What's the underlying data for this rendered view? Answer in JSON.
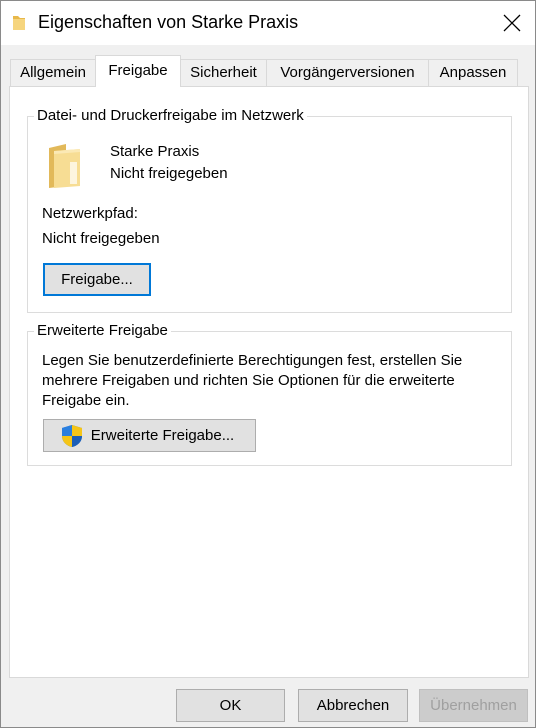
{
  "window": {
    "title": "Eigenschaften von Starke Praxis"
  },
  "tabs": [
    {
      "label": "Allgemein"
    },
    {
      "label": "Freigabe"
    },
    {
      "label": "Sicherheit"
    },
    {
      "label": "Vorgängerversionen"
    },
    {
      "label": "Anpassen"
    }
  ],
  "active_tab": "Freigabe",
  "network_sharing": {
    "title": "Datei- und Druckerfreigabe im Netzwerk",
    "folder_name": "Starke Praxis",
    "share_status": "Nicht freigegeben",
    "path_label": "Netzwerkpfad:",
    "path_value": "Nicht freigegeben",
    "share_button": "Freigabe..."
  },
  "advanced_sharing": {
    "title": "Erweiterte Freigabe",
    "description": "Legen Sie benutzerdefinierte Berechtigungen fest, erstellen Sie mehrere Freigaben und richten Sie Optionen für die erweiterte Freigabe ein.",
    "button": "Erweiterte Freigabe..."
  },
  "footer": {
    "ok": "OK",
    "cancel": "Abbrechen",
    "apply": "Übernehmen"
  },
  "colors": {
    "focus_border": "#0078d7",
    "folder": "#f3d27a",
    "shield_blue": "#1c6fd1",
    "shield_yellow": "#f5c518"
  }
}
